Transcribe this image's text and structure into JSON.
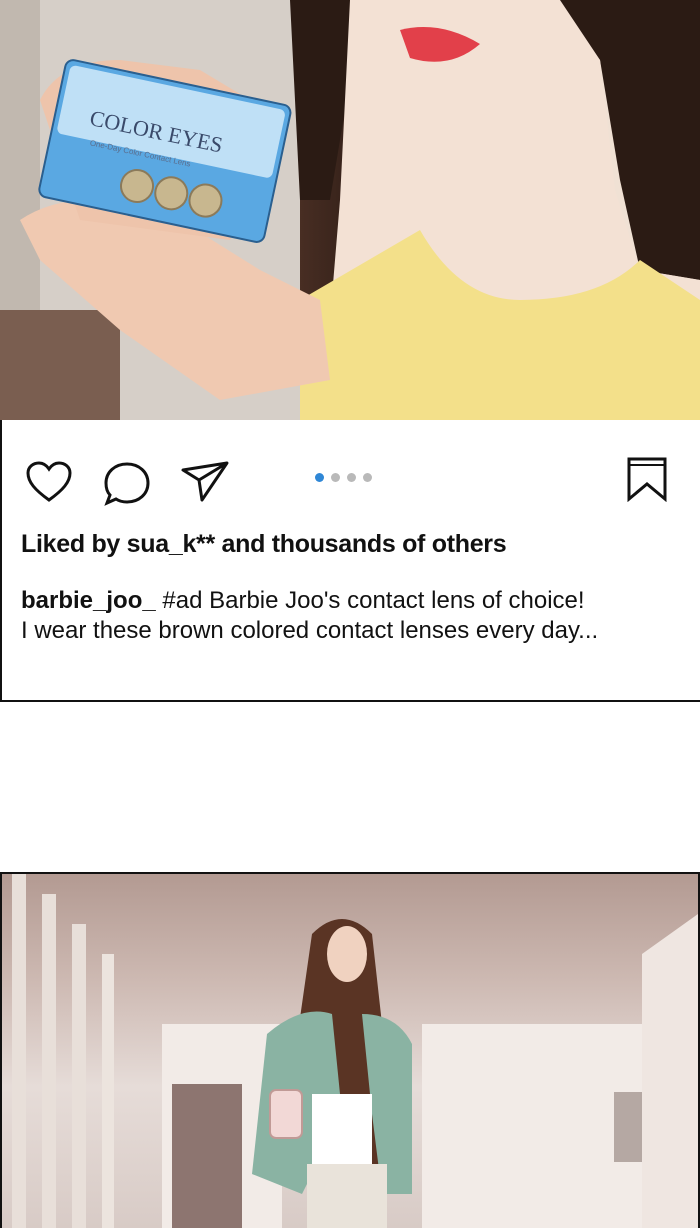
{
  "top_panel": {
    "box_brand": "COLOR EYES",
    "box_subtitle": "One-Day Color Contact Lens"
  },
  "post": {
    "carousel": {
      "count": 4,
      "active_index": 0
    },
    "liked_text": "Liked by sua_k** and thousands of others",
    "caption_user": "barbie_joo_",
    "caption_line1": "#ad Barbie Joo's contact lens of choice!",
    "caption_line2": "I wear these brown colored contact lenses every day..."
  },
  "icons": [
    "heart-icon",
    "comment-icon",
    "send-icon",
    "bookmark-icon"
  ],
  "colors": {
    "dot_active": "#2f87d6",
    "dot_inactive": "#b9b9b9",
    "shirt": "#f3e08a",
    "box": "#5aa8e2"
  }
}
